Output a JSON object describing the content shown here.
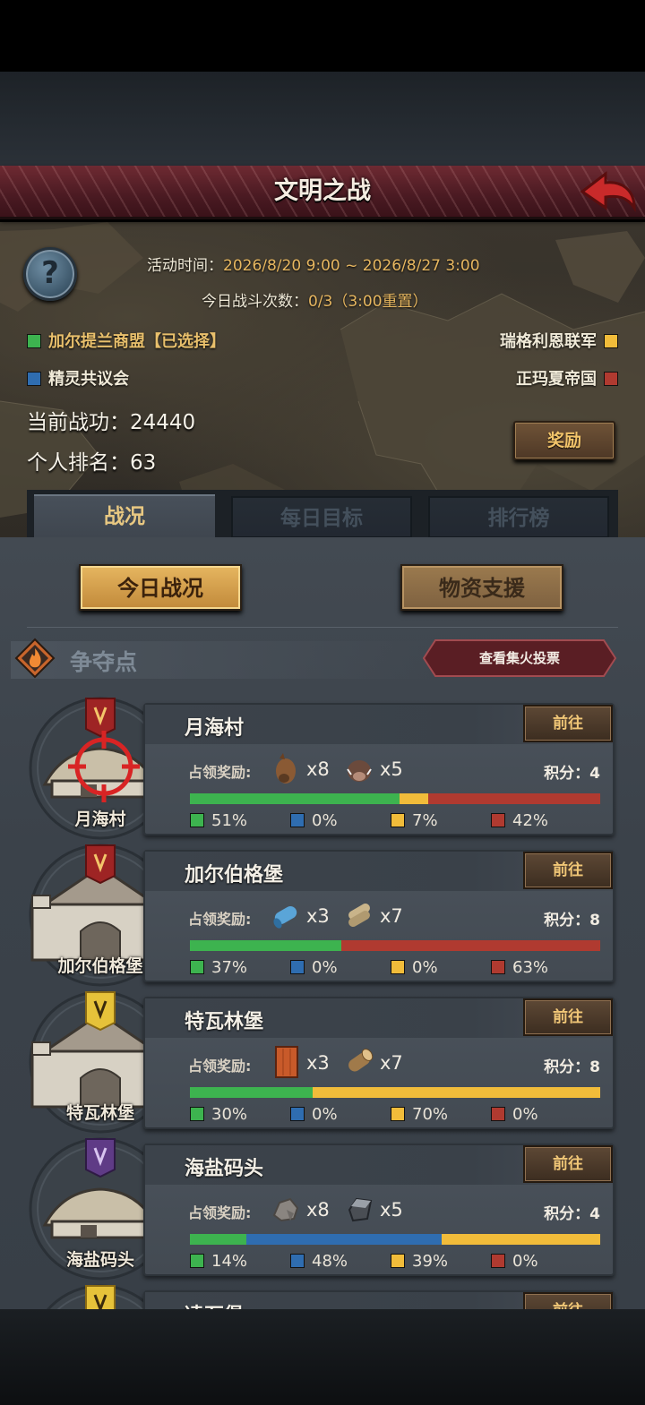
{
  "header": {
    "title": "文明之战"
  },
  "event": {
    "time_label": "活动时间：",
    "time_value": "2026/8/20 9:00 ~ 2026/8/27 3:00",
    "battles_label": "今日战斗次数：",
    "battles_value": "0/3（3:00重置）"
  },
  "factions": [
    {
      "name": "加尔提兰商盟【已选择】",
      "color": "#3db34f"
    },
    {
      "name": "瑞格利恩联军",
      "color": "#f1bc3a"
    },
    {
      "name": "精灵共议会",
      "color": "#2f6db0"
    },
    {
      "name": "正玛夏帝国",
      "color": "#b03a30"
    }
  ],
  "stats": {
    "merit_label": "当前战功：",
    "merit_value": "24440",
    "rank_label": "个人排名：",
    "rank_value": "63",
    "reward_button": "奖励"
  },
  "tabs": [
    {
      "label": "战况",
      "active": true
    },
    {
      "label": "每日目标",
      "active": false
    },
    {
      "label": "排行榜",
      "active": false
    }
  ],
  "sub_tabs": [
    {
      "label": "今日战况",
      "selected": true
    },
    {
      "label": "物资支援",
      "selected": false
    }
  ],
  "section": {
    "title": "争夺点",
    "vote_button": "查看集火投票"
  },
  "card_common": {
    "reward_label": "占领奖励:",
    "score_label": "积分：",
    "go_button": "前往"
  },
  "points": [
    {
      "name": "月海村",
      "emblem_label": "月海村",
      "banner": "red",
      "targeted": true,
      "building": "village",
      "rewards": [
        {
          "icon": "horse-icon",
          "count": "x8"
        },
        {
          "icon": "boar-icon",
          "count": "x5"
        }
      ],
      "score": "4",
      "shares": [
        51,
        0,
        7,
        42
      ],
      "shares_text": [
        "51%",
        "0%",
        "7%",
        "42%"
      ]
    },
    {
      "name": "加尔伯格堡",
      "emblem_label": "加尔伯格堡",
      "banner": "red",
      "targeted": false,
      "building": "castle",
      "rewards": [
        {
          "icon": "cloth-roll-icon",
          "count": "x3"
        },
        {
          "icon": "scroll-icon",
          "count": "x7"
        }
      ],
      "score": "8",
      "shares": [
        37,
        0,
        0,
        63
      ],
      "shares_text": [
        "37%",
        "0%",
        "0%",
        "63%"
      ]
    },
    {
      "name": "特瓦林堡",
      "emblem_label": "特瓦林堡",
      "banner": "yellow",
      "targeted": false,
      "building": "castle",
      "rewards": [
        {
          "icon": "plank-icon",
          "count": "x3"
        },
        {
          "icon": "log-icon",
          "count": "x7"
        }
      ],
      "score": "8",
      "shares": [
        30,
        0,
        70,
        0
      ],
      "shares_text": [
        "30%",
        "0%",
        "70%",
        "0%"
      ]
    },
    {
      "name": "海盐码头",
      "emblem_label": "海盐码头",
      "banner": "purple",
      "targeted": false,
      "building": "village",
      "rewards": [
        {
          "icon": "stone-icon",
          "count": "x8"
        },
        {
          "icon": "iron-ingot-icon",
          "count": "x5"
        }
      ],
      "score": "4",
      "shares": [
        14,
        48,
        39,
        0
      ],
      "shares_text": [
        "14%",
        "48%",
        "39%",
        "0%"
      ]
    },
    {
      "name": "凌石堡",
      "banner": "yellow",
      "partial": true
    }
  ],
  "colors": {
    "green": "#3db34f",
    "blue": "#2f6db0",
    "yellow": "#f1bc3a",
    "red": "#b03a30"
  }
}
